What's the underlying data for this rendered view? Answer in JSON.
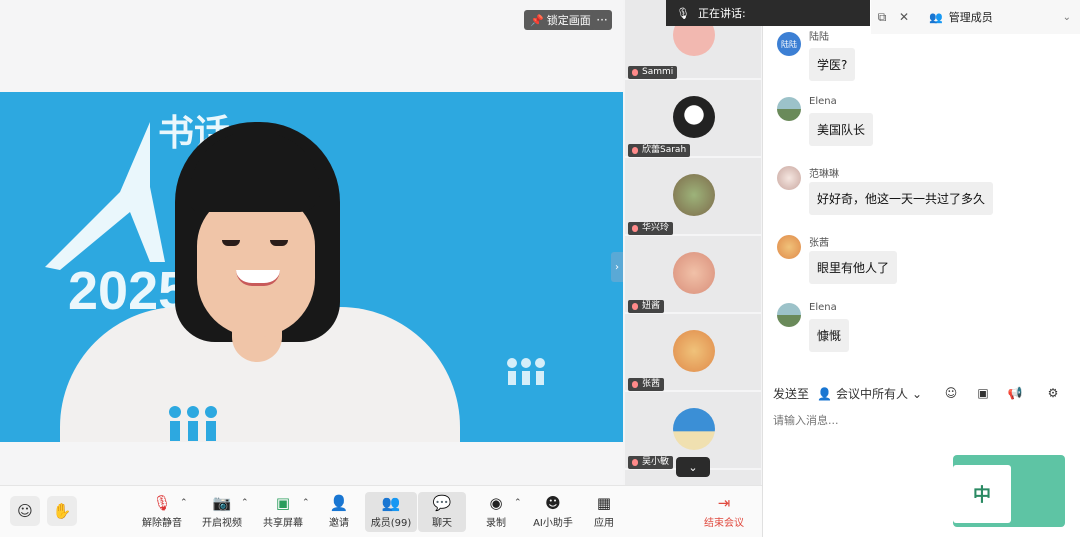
{
  "main": {
    "lock_label": "锁定画面",
    "more_label": "···",
    "background_texts": [
      "书话",
      "2025"
    ]
  },
  "speaking": {
    "label": "正在讲话:"
  },
  "participants": [
    {
      "name": "Sammi",
      "color": "#f2b8b0"
    },
    {
      "name": "欣蕾Sarah",
      "color": "#222222"
    },
    {
      "name": "华兴玲",
      "color": "#8fa36a"
    },
    {
      "name": "妞酱",
      "color": "#e7a58e"
    },
    {
      "name": "张茜",
      "color": "#e8b24a"
    },
    {
      "name": "吴小敏",
      "color": "#3b8fd6"
    }
  ],
  "chat_header": {
    "manage_label": "管理成员"
  },
  "messages": [
    {
      "name": "陆陆",
      "text": "学医?",
      "avatar_text": "陆陆",
      "avatar_color": "#3c7fd4"
    },
    {
      "name": "Elena",
      "text": "美国队长",
      "avatar_color": "#7a9c7e"
    },
    {
      "name": "范琳琳",
      "text": "好好奇，他这一天一共过了多久",
      "avatar_color": "#d9c7c0"
    },
    {
      "name": "张茜",
      "text": "眼里有他人了",
      "avatar_color": "#e8b24a"
    },
    {
      "name": "Elena",
      "text": "慷慨",
      "avatar_color": "#7a9c7e"
    }
  ],
  "composer": {
    "sendto_label": "发送至",
    "target_label": "会议中所有人",
    "placeholder": "请输入消息..."
  },
  "sticker": {
    "text": "中"
  },
  "toolbar": {
    "items": [
      {
        "label": "解除静音"
      },
      {
        "label": "开启视频"
      },
      {
        "label": "共享屏幕"
      },
      {
        "label": "邀请"
      },
      {
        "label": "成员(99)"
      },
      {
        "label": "聊天"
      },
      {
        "label": "录制"
      },
      {
        "label": "AI小助手"
      },
      {
        "label": "应用"
      },
      {
        "label": "结束会议"
      }
    ]
  }
}
